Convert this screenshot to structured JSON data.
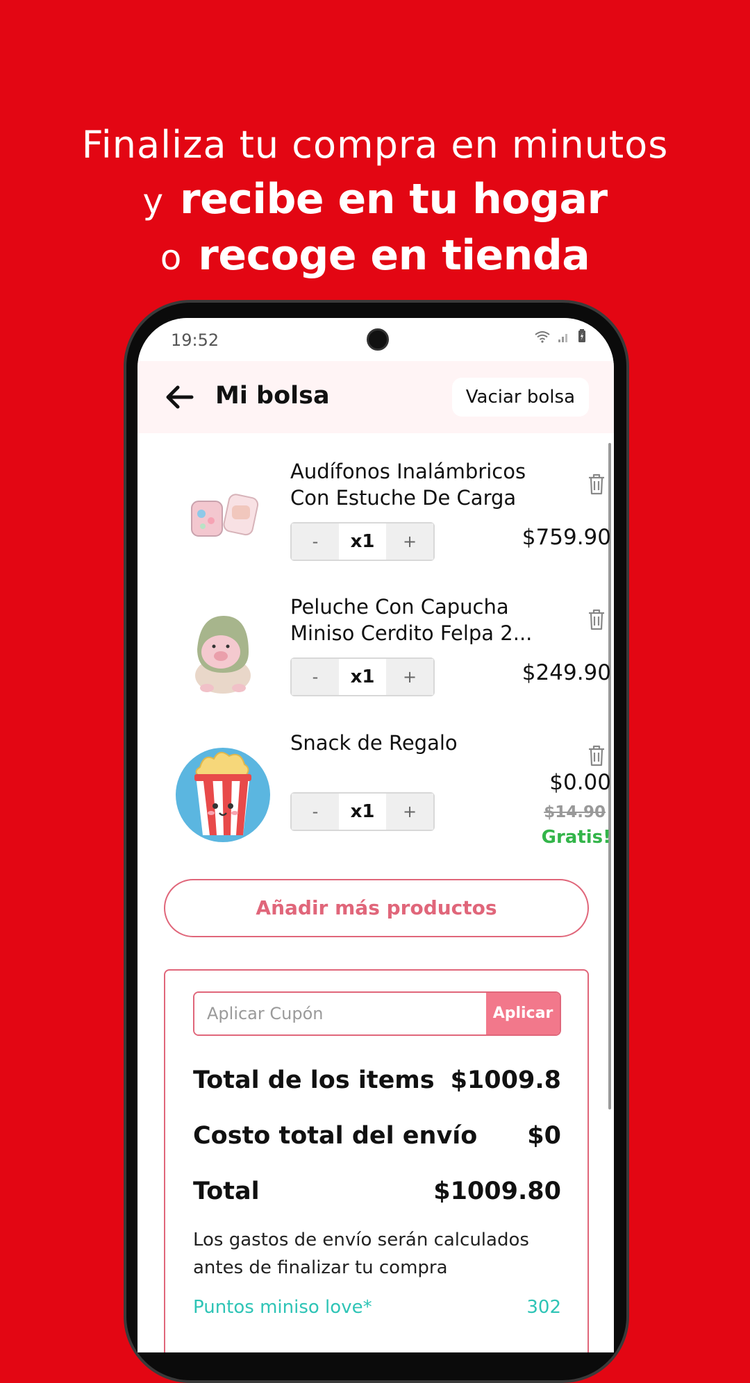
{
  "promo": {
    "line1": "Finaliza tu compra en minutos",
    "line2_prefix": "y",
    "line2_bold": "recibe en tu hogar",
    "line3_prefix": "o",
    "line3_bold": "recoge en tienda"
  },
  "status_bar": {
    "time": "19:52",
    "icons": [
      "wifi-icon",
      "signal-icon",
      "battery-icon"
    ]
  },
  "header": {
    "title": "Mi bolsa",
    "clear_label": "Vaciar bolsa"
  },
  "items": [
    {
      "name": "Audífonos Inalámbricos Con Estuche De Carga ...",
      "qty": "x1",
      "minus": "-",
      "plus": "+",
      "price": "$759.90"
    },
    {
      "name": "Peluche Con Capucha Miniso Cerdito Felpa 2...",
      "qty": "x1",
      "minus": "-",
      "plus": "+",
      "price": "$249.90"
    },
    {
      "name": "Snack de Regalo",
      "qty": "x1",
      "minus": "-",
      "plus": "+",
      "price": "$0.00",
      "original_price": "$14.90",
      "badge": "Gratis!"
    }
  ],
  "add_more_label": "Añadir más productos",
  "coupon": {
    "placeholder": "Aplicar Cupón",
    "apply_label": "Aplicar"
  },
  "summary": {
    "items_total_label": "Total de los items",
    "items_total_value": "$1009.8",
    "shipping_label": "Costo total del envío",
    "shipping_value": "$0",
    "total_label": "Total",
    "total_value": "$1009.80",
    "note": "Los gastos de envío serán calculados antes de finalizar tu compra",
    "points_label": "Puntos miniso love*",
    "points_value": "302"
  },
  "colors": {
    "background": "#e30613",
    "accent": "#e0667a",
    "apply_button": "#f2788b",
    "free": "#33b54a",
    "points": "#2ec4b6"
  }
}
